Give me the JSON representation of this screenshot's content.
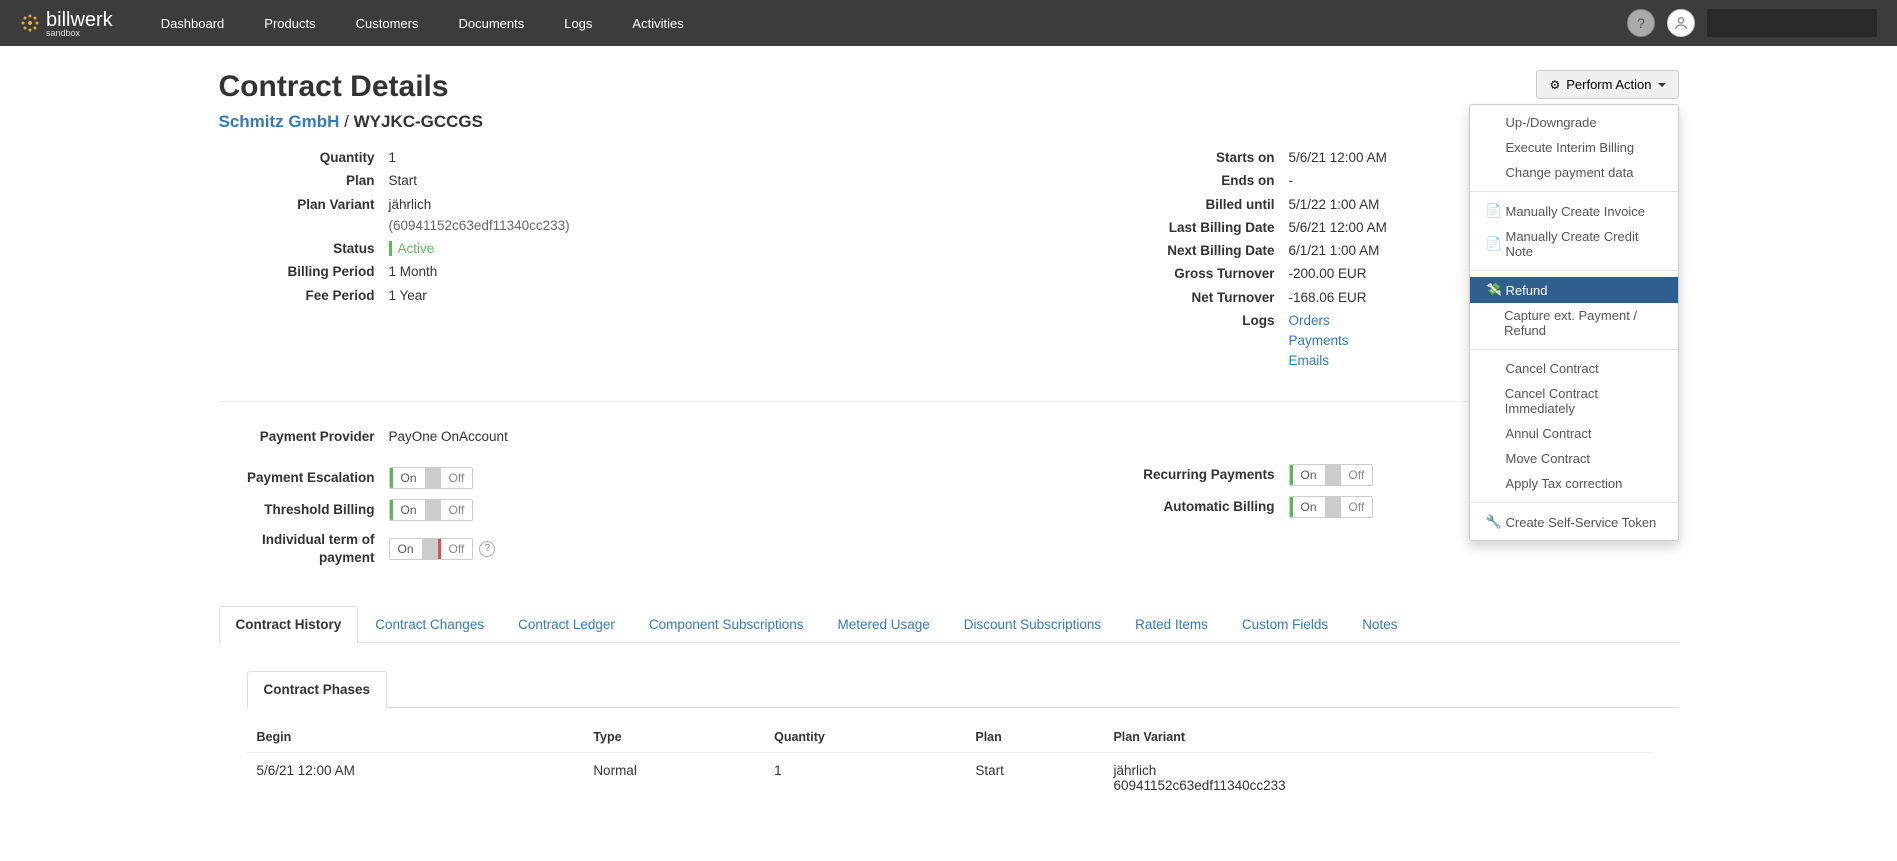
{
  "brand": {
    "name": "billwerk",
    "sub": "sandbox"
  },
  "nav": {
    "items": [
      "Dashboard",
      "Products",
      "Customers",
      "Documents",
      "Logs",
      "Activities"
    ]
  },
  "page": {
    "title": "Contract Details",
    "customer": "Schmitz GmbH",
    "contract_code": "WYJKC-GCCGS"
  },
  "action": {
    "label": "Perform Action",
    "menu": {
      "updown": "Up-/Downgrade",
      "interim": "Execute Interim Billing",
      "change_payment": "Change payment data",
      "create_invoice": "Manually Create Invoice",
      "create_credit": "Manually Create Credit Note",
      "refund": "Refund",
      "capture": "Capture ext. Payment / Refund",
      "cancel": "Cancel Contract",
      "cancel_imm": "Cancel Contract Immediately",
      "annul": "Annul Contract",
      "move": "Move Contract",
      "tax": "Apply Tax correction",
      "selfservice": "Create Self-Service Token"
    }
  },
  "details_left": {
    "quantity_label": "Quantity",
    "quantity": "1",
    "plan_label": "Plan",
    "plan": "Start",
    "variant_label": "Plan Variant",
    "variant": "jährlich",
    "variant_id": "(60941152c63edf11340cc233)",
    "status_label": "Status",
    "status": "Active",
    "billing_period_label": "Billing Period",
    "billing_period": "1 Month",
    "fee_period_label": "Fee Period",
    "fee_period": "1 Year"
  },
  "details_right": {
    "starts_label": "Starts on",
    "starts": "5/6/21 12:00 AM",
    "ends_label": "Ends on",
    "ends": "-",
    "billed_until_label": "Billed until",
    "billed_until": "5/1/22 1:00 AM",
    "last_billing_label": "Last Billing Date",
    "last_billing": "5/6/21 12:00 AM",
    "next_billing_label": "Next Billing Date",
    "next_billing": "6/1/21 1:00 AM",
    "gross_label": "Gross Turnover",
    "gross": "-200.00 EUR",
    "net_label": "Net Turnover",
    "net": "-168.06 EUR",
    "logs_label": "Logs",
    "logs": {
      "orders": "Orders",
      "payments": "Payments",
      "emails": "Emails"
    }
  },
  "payment": {
    "provider_label": "Payment Provider",
    "provider": "PayOne OnAccount",
    "escalation_label": "Payment Escalation",
    "threshold_label": "Threshold Billing",
    "term_label": "Individual term of payment",
    "recurring_label": "Recurring Payments",
    "automatic_label": "Automatic Billing",
    "on": "On",
    "off": "Off"
  },
  "tabs": {
    "history": "Contract History",
    "changes": "Contract Changes",
    "ledger": "Contract Ledger",
    "component": "Component Subscriptions",
    "metered": "Metered Usage",
    "discount": "Discount Subscriptions",
    "rated": "Rated Items",
    "custom": "Custom Fields",
    "notes": "Notes"
  },
  "subtab": {
    "phases": "Contract Phases"
  },
  "table": {
    "headers": {
      "begin": "Begin",
      "type": "Type",
      "quantity": "Quantity",
      "plan": "Plan",
      "variant": "Plan Variant"
    },
    "row": {
      "begin": "5/6/21 12:00 AM",
      "type": "Normal",
      "quantity": "1",
      "plan": "Start",
      "variant": "jährlich",
      "variant_id": "60941152c63edf11340cc233"
    }
  }
}
